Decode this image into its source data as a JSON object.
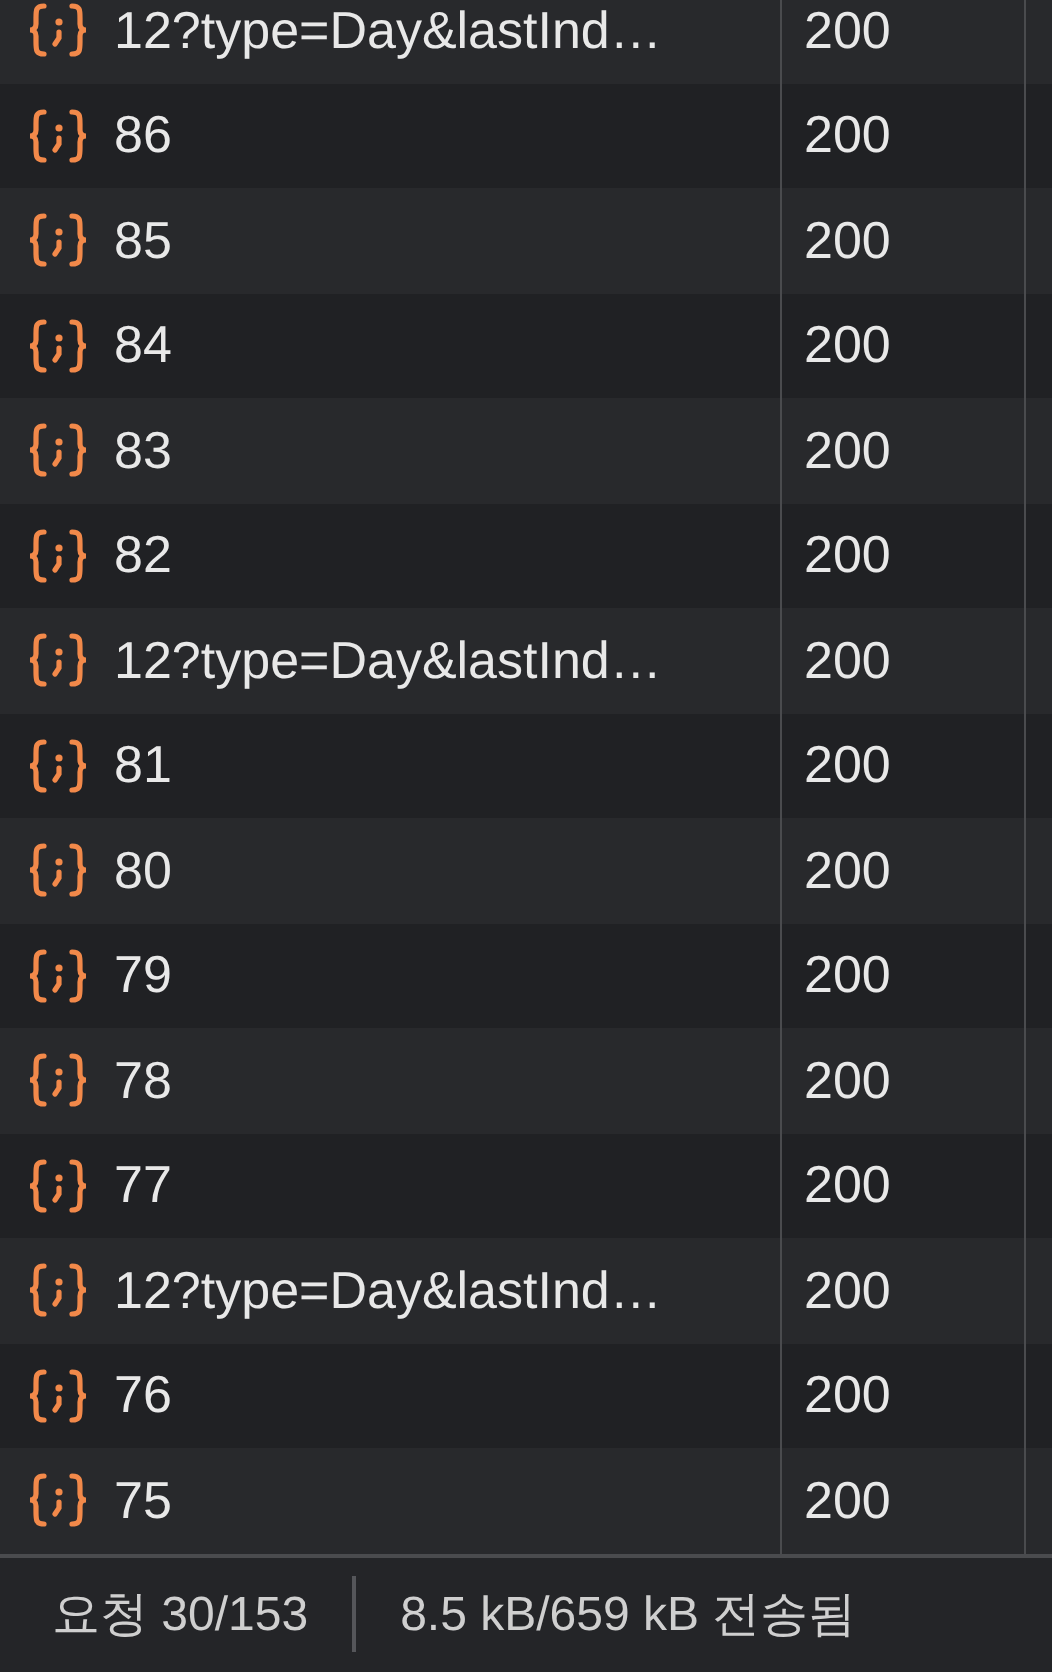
{
  "table": {
    "rows": [
      {
        "name": "12?type=Day&lastInd…",
        "status": "200"
      },
      {
        "name": "86",
        "status": "200"
      },
      {
        "name": "85",
        "status": "200"
      },
      {
        "name": "84",
        "status": "200"
      },
      {
        "name": "83",
        "status": "200"
      },
      {
        "name": "82",
        "status": "200"
      },
      {
        "name": "12?type=Day&lastInd…",
        "status": "200"
      },
      {
        "name": "81",
        "status": "200"
      },
      {
        "name": "80",
        "status": "200"
      },
      {
        "name": "79",
        "status": "200"
      },
      {
        "name": "78",
        "status": "200"
      },
      {
        "name": "77",
        "status": "200"
      },
      {
        "name": "12?type=Day&lastInd…",
        "status": "200"
      },
      {
        "name": "76",
        "status": "200"
      },
      {
        "name": "75",
        "status": "200"
      }
    ]
  },
  "status_bar": {
    "requests": "요청 30/153",
    "transferred": "8.5 kB/659 kB 전송됨"
  }
}
